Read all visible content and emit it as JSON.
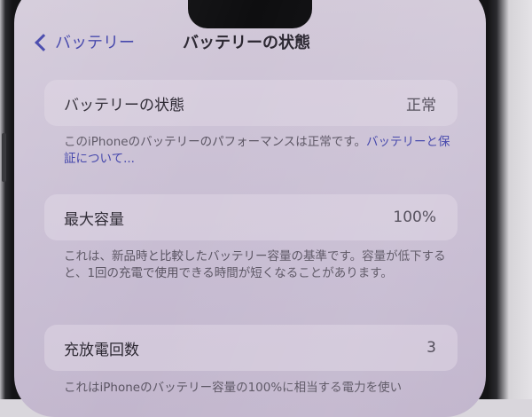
{
  "nav": {
    "back_label": "バッテリー",
    "title": "バッテリーの状態"
  },
  "battery_health": {
    "label": "バッテリーの状態",
    "value": "正常",
    "note": "このiPhoneのバッテリーのパフォーマンスは正常です。",
    "link_text": "バッテリーと保証について..."
  },
  "max_capacity": {
    "label": "最大容量",
    "value": "100%",
    "note": "これは、新品時と比較したバッテリー容量の基準です。容量が低下すると、1回の充電で使用できる時間が短くなることがあります。"
  },
  "cycle_count": {
    "label": "充放電回数",
    "value": "3",
    "note": "これはiPhoneのバッテリー容量の100%に相当する電力を使い"
  },
  "colors": {
    "accent": "#3d3fa8",
    "screen_bg": "#cdc3d6",
    "text": "#2a2630"
  }
}
